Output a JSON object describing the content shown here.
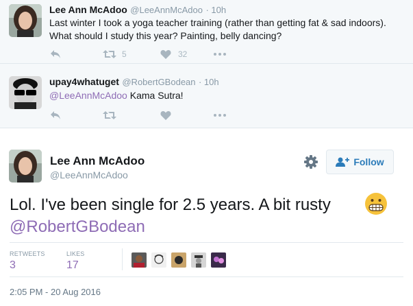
{
  "tweets": [
    {
      "name": "Lee Ann McAdoo",
      "handle": "@LeeAnnMcAdoo",
      "time": "· 10h",
      "text": "Last winter I took a yoga teacher training (rather than getting fat & sad indoors). What should I study this year? Painting, belly dancing?",
      "retweets": "5",
      "likes": "32"
    },
    {
      "name": "upay4whatuget",
      "handle": "@RobertGBodean",
      "time": "· 10h",
      "mention": "@LeeAnnMcAdoo",
      "text": " Kama Sutra!"
    }
  ],
  "main_tweet": {
    "name": "Lee Ann McAdoo",
    "handle": "@LeeAnnMcAdoo",
    "follow_label": "Follow",
    "text": "Lol. I've been single for 2.5 years. A bit rusty",
    "mention": "@RobertGBodean",
    "retweets_label": "RETWEETS",
    "retweets": "3",
    "likes_label": "LIKES",
    "likes": "17",
    "timestamp": "2:05 PM - 20 Aug 2016"
  },
  "icons": [
    "reply-icon",
    "retweet-icon",
    "heart-icon",
    "more-icon",
    "gear-icon",
    "follow-person-icon",
    "grimacing-emoji-icon"
  ]
}
